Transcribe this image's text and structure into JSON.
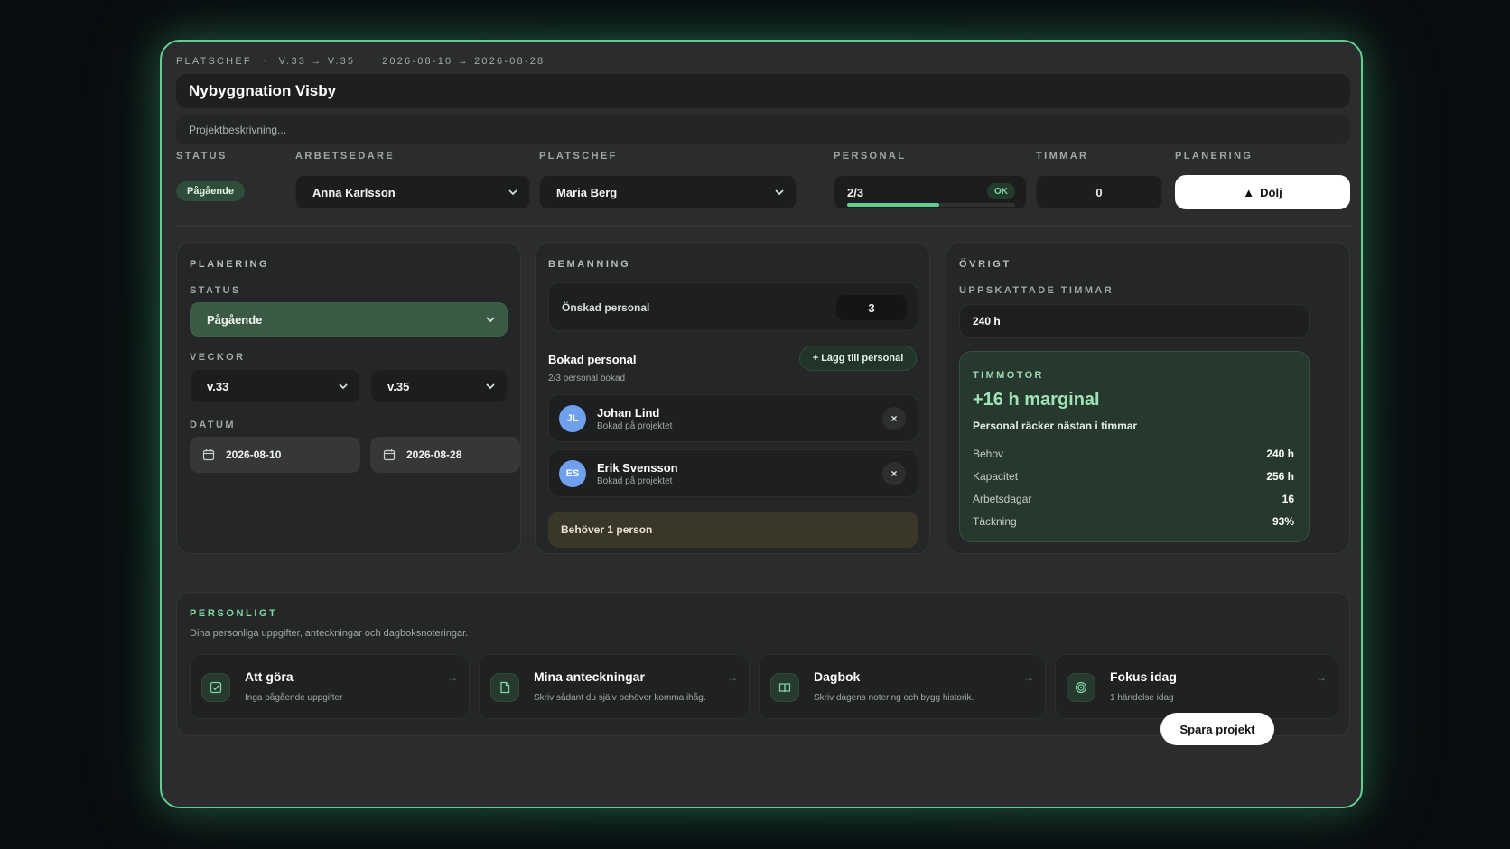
{
  "header": {
    "role": "PLATSCHEF",
    "weeks": "V.33 → V.35",
    "dates": "2026-08-10 → 2026-08-28",
    "title": "Nybyggnation Visby",
    "description_placeholder": "Projektbeskrivning..."
  },
  "summary": {
    "status_label": "STATUS",
    "status_value": "Pågående",
    "arbetsledare_label": "ARBETSEDARE",
    "arbetsledare_value": "Anna Karlsson",
    "platschef_label": "PLATSCHEF",
    "platschef_value": "Maria Berg",
    "personal_label": "PERSONAL",
    "personal_value": "2/3",
    "personal_badge": "OK",
    "personal_fill": 0.55,
    "timmar_label": "TIMMAR",
    "timmar_value": "0",
    "planering_label": "PLANERING",
    "hide_button": "Dölj"
  },
  "planering": {
    "title": "PLANERING",
    "status_label": "STATUS",
    "status_value": "Pågående",
    "veckor_label": "VECKOR",
    "week_from": "v.33",
    "week_to": "v.35",
    "datum_label": "DATUM",
    "date_from": "2026-08-10",
    "date_to": "2026-08-28"
  },
  "bemanning": {
    "title": "BEMANNING",
    "onskad_label": "Önskad personal",
    "onskad_value": "3",
    "bokad_title": "Bokad personal",
    "bokad_sub": "2/3 personal bokad",
    "add_button": "+ Lägg till personal",
    "people": [
      {
        "initials": "JL",
        "name": "Johan Lind",
        "status": "Bokad på projektet"
      },
      {
        "initials": "ES",
        "name": "Erik Svensson",
        "status": "Bokad på projektet"
      }
    ],
    "warning": "Behöver 1 person"
  },
  "ovrigt": {
    "title": "ÖVRIGT",
    "uppskattade_label": "UPPSKATTADE TIMMAR",
    "uppskattade_value": "240 h",
    "timmotor_label": "TIMMOTOR",
    "marginal": "+16 h marginal",
    "marginal_sub": "Personal räcker nästan i timmar",
    "rows": [
      {
        "k": "Behov",
        "v": "240 h"
      },
      {
        "k": "Kapacitet",
        "v": "256 h"
      },
      {
        "k": "Arbetsdagar",
        "v": "16"
      },
      {
        "k": "Täckning",
        "v": "93%"
      }
    ]
  },
  "personligt": {
    "title": "PERSONLIGT",
    "sub": "Dina personliga uppgifter, anteckningar och dagboksnoteringar.",
    "cards": [
      {
        "title": "Att göra",
        "sub": "Inga pågående uppgifter",
        "icon": "checkbox-icon"
      },
      {
        "title": "Mina anteckningar",
        "sub": "Skriv sådant du själv behöver komma ihåg.",
        "icon": "document-icon"
      },
      {
        "title": "Dagbok",
        "sub": "Skriv dagens notering och bygg historik.",
        "icon": "book-icon"
      },
      {
        "title": "Fokus idag",
        "sub": "1 händelse idag",
        "icon": "target-icon"
      }
    ]
  },
  "footer": {
    "save_button": "Spara projekt"
  },
  "colors": {
    "accent": "#5fcf8f",
    "background": "#2a2c2d",
    "page": "#0a0d0f",
    "avatar": "#6fa0ee"
  }
}
